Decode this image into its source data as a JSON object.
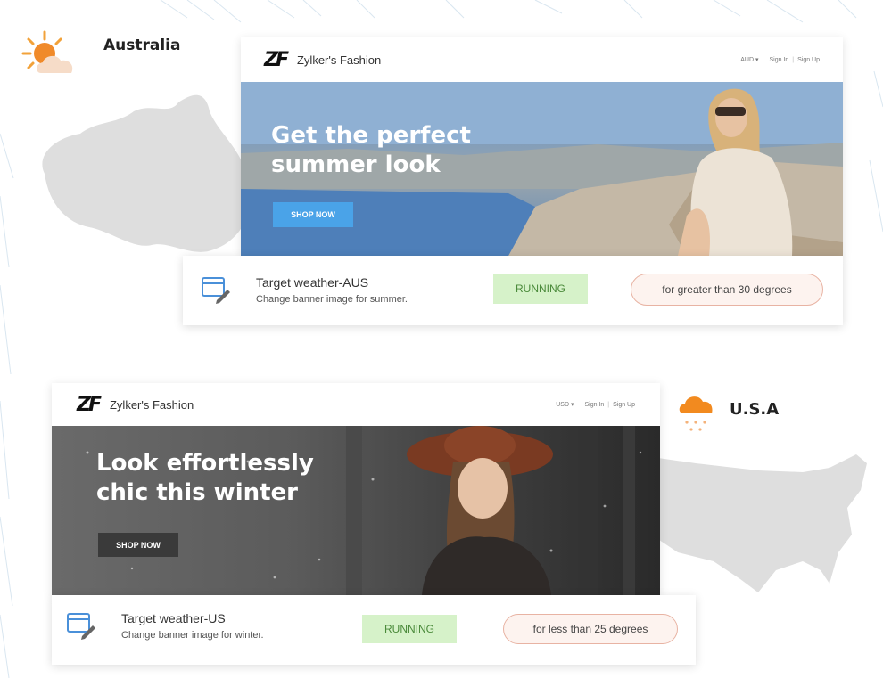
{
  "colors": {
    "status_bg": "#d6f2c9",
    "status_text": "#4a8a3a",
    "condition_border": "#e8b3a3",
    "aus_button": "#4aa3e8",
    "us_button": "#3a3a3a"
  },
  "australia": {
    "region_label": "Australia",
    "weather_icon": "sun-cloud-icon",
    "site": {
      "brand_logo": "ZF",
      "brand_name": "Zylker's Fashion",
      "currency": "AUD ▾",
      "sign_in": "Sign In",
      "sign_up": "Sign Up",
      "banner_title_line1": "Get the perfect",
      "banner_title_line2": "summer look",
      "shop_button": "SHOP NOW"
    },
    "rule": {
      "title": "Target weather-AUS",
      "description": "Change banner image for summer.",
      "status": "RUNNING",
      "condition": "for greater than 30 degrees"
    }
  },
  "usa": {
    "region_label": "U.S.A",
    "weather_icon": "snow-cloud-icon",
    "site": {
      "brand_logo": "ZF",
      "brand_name": "Zylker's Fashion",
      "currency": "USD ▾",
      "sign_in": "Sign In",
      "sign_up": "Sign Up",
      "banner_title_line1": "Look effortlessly",
      "banner_title_line2": "chic this winter",
      "shop_button": "SHOP NOW"
    },
    "rule": {
      "title": "Target weather-US",
      "description": "Change banner image for winter.",
      "status": "RUNNING",
      "condition": "for less than 25 degrees"
    }
  }
}
